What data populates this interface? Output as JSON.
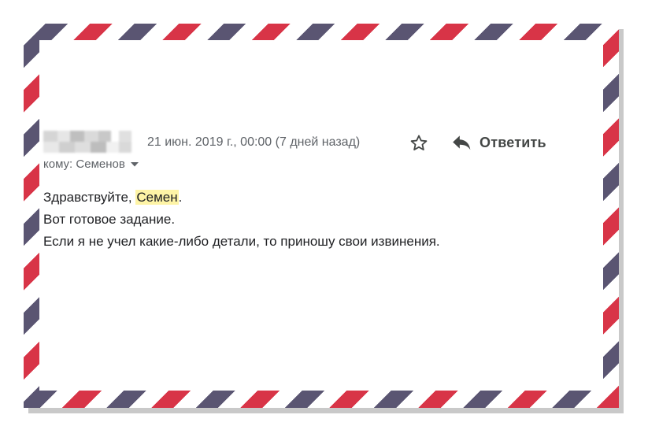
{
  "email": {
    "date": "21 июн. 2019 г., 00:00 (7 дней назад)",
    "star_icon": "star-outline-icon",
    "reply_icon": "reply-arrow-icon",
    "reply_label": "Ответить",
    "recipient_label": "кому: Семенов",
    "dropdown_icon": "caret-down-icon",
    "body": {
      "greeting_prefix": "Здравствуйте,",
      "greeting_name": "Семен",
      "greeting_suffix": ".",
      "line2": "Вот готовое задание.",
      "line3": "Если я не учел какие-либо детали, то приношу свои извинения."
    }
  },
  "colors": {
    "stripe_red": "#d83447",
    "stripe_navy": "#5a5572",
    "highlight": "#fef4a6"
  }
}
